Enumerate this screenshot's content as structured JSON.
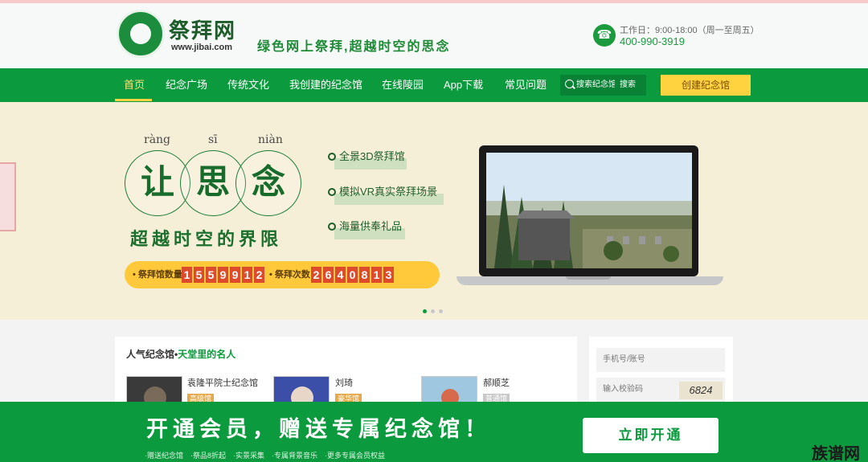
{
  "header": {
    "brand": "祭拜网",
    "url": "www.jibai.com",
    "slogan": "绿色网上祭拜,超越时空的思念",
    "work_hours": "工作日：9:00-18:00（周一至周五）",
    "hotline": "400-990-3919"
  },
  "nav": {
    "items": [
      {
        "label": "首页",
        "active": true
      },
      {
        "label": "纪念广场"
      },
      {
        "label": "传统文化"
      },
      {
        "label": "我创建的纪念馆"
      },
      {
        "label": "在线陵园"
      },
      {
        "label": "App下载"
      },
      {
        "label": "常见问题"
      }
    ],
    "search_placeholder": "搜索纪念馆",
    "search_button": "搜索",
    "create_button": "创建纪念馆"
  },
  "banner": {
    "pinyin": [
      "ràng",
      "sī",
      "niàn"
    ],
    "chars": [
      "让",
      "思",
      "念"
    ],
    "tagline": "超越时空的界限",
    "features": [
      "全景3D祭拜馆",
      "模拟VR真实祭拜场景",
      "海量供奉礼品"
    ],
    "stats": {
      "hall_label": "• 祭拜馆数量",
      "hall_digits": [
        "1",
        "5",
        "5",
        "9",
        "9",
        "1",
        "2"
      ],
      "visit_label": "• 祭拜次数",
      "visit_digits": [
        "2",
        "6",
        "4",
        "0",
        "8",
        "1",
        "3"
      ]
    }
  },
  "popular": {
    "title": "人气纪念馆•",
    "subtitle": "天堂里的名人",
    "cards": [
      {
        "name": "袁隆平院士纪念馆",
        "badge": "高级馆"
      },
      {
        "name": "刘琦",
        "badge": "豪华馆"
      },
      {
        "name": "郝顺芝",
        "badge": "普通馆"
      }
    ]
  },
  "login": {
    "phone_placeholder": "手机号/账号",
    "code_placeholder": "输入校验码",
    "captcha": "6824"
  },
  "promo": {
    "title": "开通会员，赠送专属纪念馆！",
    "perks": "·赠送纪念馆　·祭品8折起　·实景采集　·专属背景音乐　·更多专属会员权益",
    "button": "立即开通"
  },
  "watermark": "族谱网",
  "colors": {
    "primary": "#0c9a3e",
    "accent": "#ffd23f",
    "digit": "#dd4b2c"
  }
}
